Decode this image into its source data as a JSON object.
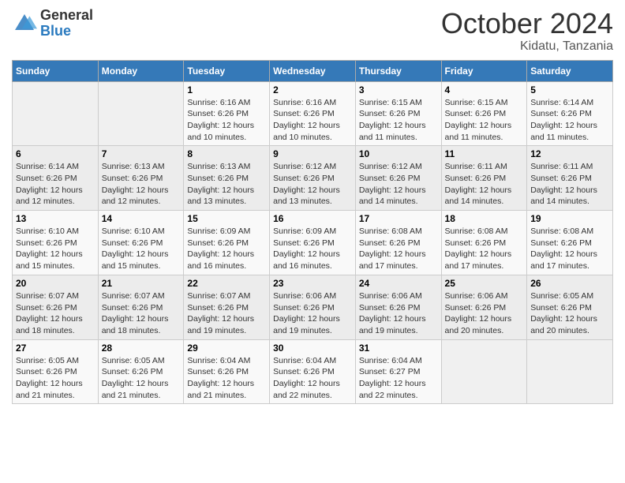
{
  "header": {
    "logo_general": "General",
    "logo_blue": "Blue",
    "month": "October 2024",
    "location": "Kidatu, Tanzania"
  },
  "weekdays": [
    "Sunday",
    "Monday",
    "Tuesday",
    "Wednesday",
    "Thursday",
    "Friday",
    "Saturday"
  ],
  "weeks": [
    [
      {
        "day": "",
        "info": ""
      },
      {
        "day": "",
        "info": ""
      },
      {
        "day": "1",
        "info": "Sunrise: 6:16 AM\nSunset: 6:26 PM\nDaylight: 12 hours and 10 minutes."
      },
      {
        "day": "2",
        "info": "Sunrise: 6:16 AM\nSunset: 6:26 PM\nDaylight: 12 hours and 10 minutes."
      },
      {
        "day": "3",
        "info": "Sunrise: 6:15 AM\nSunset: 6:26 PM\nDaylight: 12 hours and 11 minutes."
      },
      {
        "day": "4",
        "info": "Sunrise: 6:15 AM\nSunset: 6:26 PM\nDaylight: 12 hours and 11 minutes."
      },
      {
        "day": "5",
        "info": "Sunrise: 6:14 AM\nSunset: 6:26 PM\nDaylight: 12 hours and 11 minutes."
      }
    ],
    [
      {
        "day": "6",
        "info": "Sunrise: 6:14 AM\nSunset: 6:26 PM\nDaylight: 12 hours and 12 minutes."
      },
      {
        "day": "7",
        "info": "Sunrise: 6:13 AM\nSunset: 6:26 PM\nDaylight: 12 hours and 12 minutes."
      },
      {
        "day": "8",
        "info": "Sunrise: 6:13 AM\nSunset: 6:26 PM\nDaylight: 12 hours and 13 minutes."
      },
      {
        "day": "9",
        "info": "Sunrise: 6:12 AM\nSunset: 6:26 PM\nDaylight: 12 hours and 13 minutes."
      },
      {
        "day": "10",
        "info": "Sunrise: 6:12 AM\nSunset: 6:26 PM\nDaylight: 12 hours and 14 minutes."
      },
      {
        "day": "11",
        "info": "Sunrise: 6:11 AM\nSunset: 6:26 PM\nDaylight: 12 hours and 14 minutes."
      },
      {
        "day": "12",
        "info": "Sunrise: 6:11 AM\nSunset: 6:26 PM\nDaylight: 12 hours and 14 minutes."
      }
    ],
    [
      {
        "day": "13",
        "info": "Sunrise: 6:10 AM\nSunset: 6:26 PM\nDaylight: 12 hours and 15 minutes."
      },
      {
        "day": "14",
        "info": "Sunrise: 6:10 AM\nSunset: 6:26 PM\nDaylight: 12 hours and 15 minutes."
      },
      {
        "day": "15",
        "info": "Sunrise: 6:09 AM\nSunset: 6:26 PM\nDaylight: 12 hours and 16 minutes."
      },
      {
        "day": "16",
        "info": "Sunrise: 6:09 AM\nSunset: 6:26 PM\nDaylight: 12 hours and 16 minutes."
      },
      {
        "day": "17",
        "info": "Sunrise: 6:08 AM\nSunset: 6:26 PM\nDaylight: 12 hours and 17 minutes."
      },
      {
        "day": "18",
        "info": "Sunrise: 6:08 AM\nSunset: 6:26 PM\nDaylight: 12 hours and 17 minutes."
      },
      {
        "day": "19",
        "info": "Sunrise: 6:08 AM\nSunset: 6:26 PM\nDaylight: 12 hours and 17 minutes."
      }
    ],
    [
      {
        "day": "20",
        "info": "Sunrise: 6:07 AM\nSunset: 6:26 PM\nDaylight: 12 hours and 18 minutes."
      },
      {
        "day": "21",
        "info": "Sunrise: 6:07 AM\nSunset: 6:26 PM\nDaylight: 12 hours and 18 minutes."
      },
      {
        "day": "22",
        "info": "Sunrise: 6:07 AM\nSunset: 6:26 PM\nDaylight: 12 hours and 19 minutes."
      },
      {
        "day": "23",
        "info": "Sunrise: 6:06 AM\nSunset: 6:26 PM\nDaylight: 12 hours and 19 minutes."
      },
      {
        "day": "24",
        "info": "Sunrise: 6:06 AM\nSunset: 6:26 PM\nDaylight: 12 hours and 19 minutes."
      },
      {
        "day": "25",
        "info": "Sunrise: 6:06 AM\nSunset: 6:26 PM\nDaylight: 12 hours and 20 minutes."
      },
      {
        "day": "26",
        "info": "Sunrise: 6:05 AM\nSunset: 6:26 PM\nDaylight: 12 hours and 20 minutes."
      }
    ],
    [
      {
        "day": "27",
        "info": "Sunrise: 6:05 AM\nSunset: 6:26 PM\nDaylight: 12 hours and 21 minutes."
      },
      {
        "day": "28",
        "info": "Sunrise: 6:05 AM\nSunset: 6:26 PM\nDaylight: 12 hours and 21 minutes."
      },
      {
        "day": "29",
        "info": "Sunrise: 6:04 AM\nSunset: 6:26 PM\nDaylight: 12 hours and 21 minutes."
      },
      {
        "day": "30",
        "info": "Sunrise: 6:04 AM\nSunset: 6:26 PM\nDaylight: 12 hours and 22 minutes."
      },
      {
        "day": "31",
        "info": "Sunrise: 6:04 AM\nSunset: 6:27 PM\nDaylight: 12 hours and 22 minutes."
      },
      {
        "day": "",
        "info": ""
      },
      {
        "day": "",
        "info": ""
      }
    ]
  ]
}
